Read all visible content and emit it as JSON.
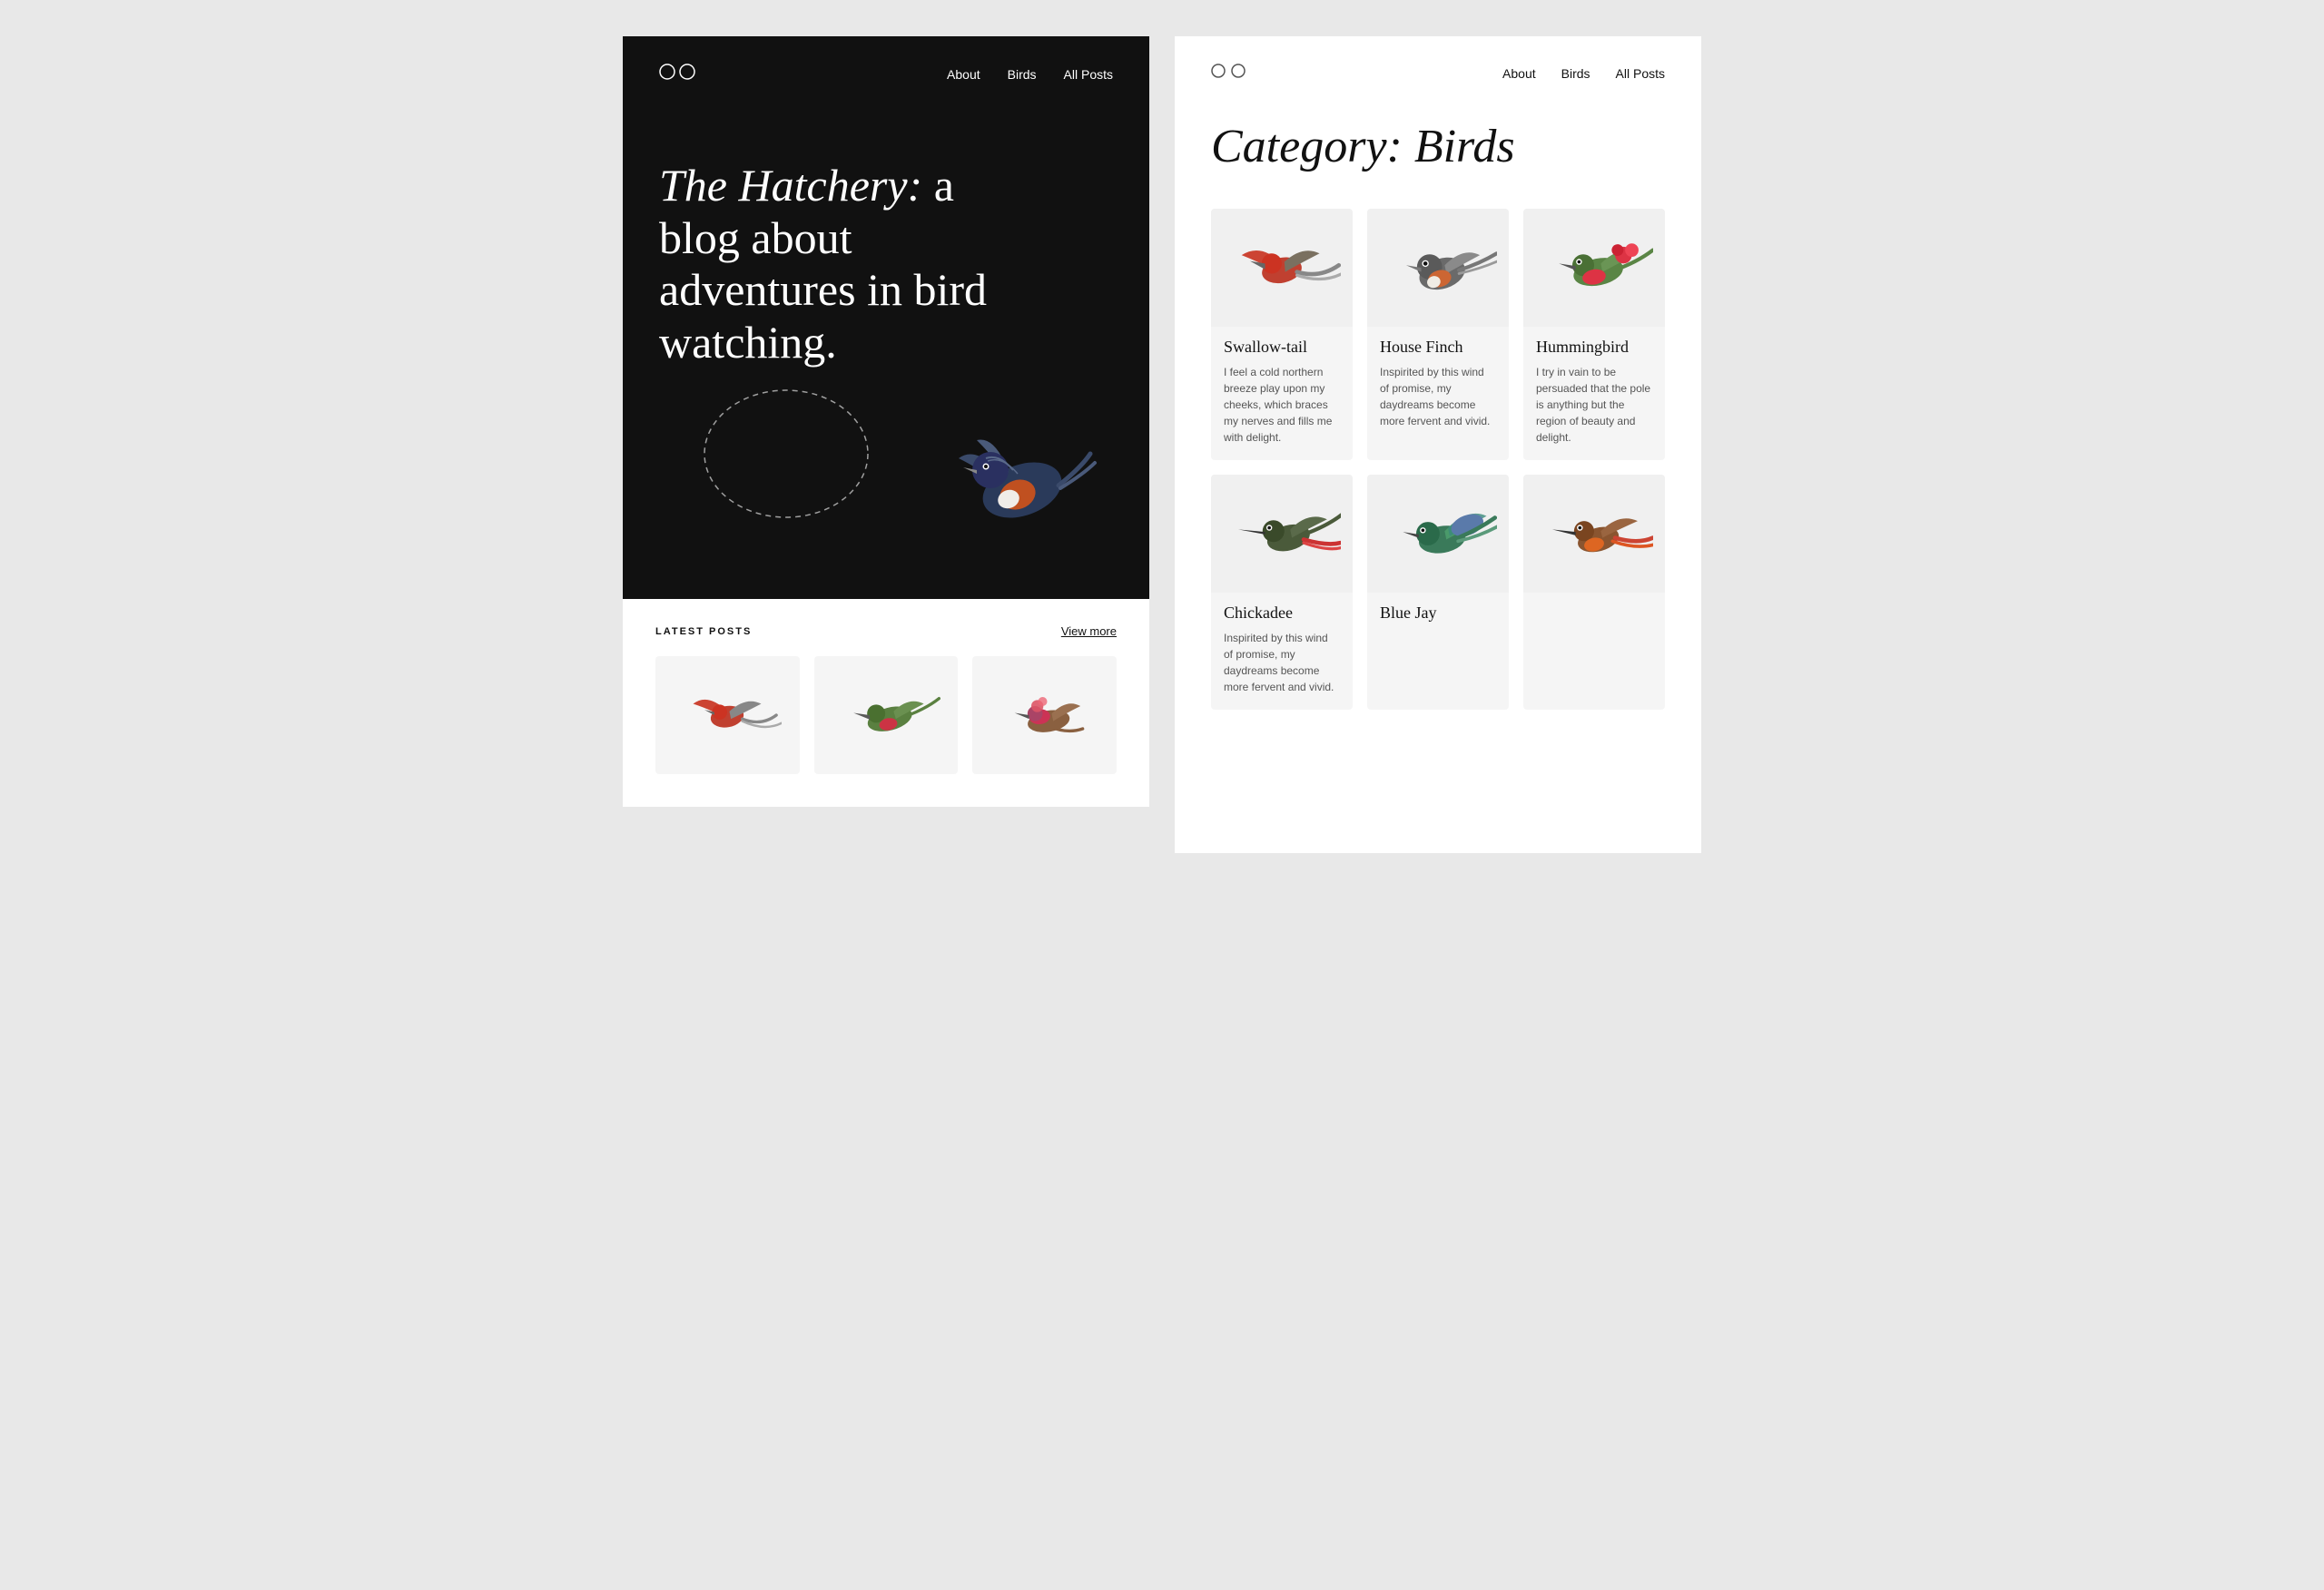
{
  "left": {
    "logo": "oo",
    "nav": {
      "links": [
        "About",
        "Birds",
        "All Posts"
      ]
    },
    "hero": {
      "title_italic": "The Hatchery:",
      "title_normal": " a blog about adventures in bird watching."
    },
    "latest": {
      "label": "LATEST POSTS",
      "view_more": "View more"
    }
  },
  "right": {
    "logo": "oo",
    "nav": {
      "links": [
        "About",
        "Birds",
        "All Posts"
      ]
    },
    "category_title": "Category: Birds",
    "birds": [
      {
        "name": "Swallow-tail",
        "desc": "I feel a cold northern breeze play upon my cheeks, which braces my nerves and fills me with delight.",
        "color": "#cc4444"
      },
      {
        "name": "House Finch",
        "desc": "Inspirited by this wind of promise, my daydreams become more fervent and vivid.",
        "color": "#888888"
      },
      {
        "name": "Hummingbird",
        "desc": "I try in vain to be persuaded that the pole is anything but the region of beauty and delight.",
        "color": "#dd4455"
      },
      {
        "name": "Chickadee",
        "desc": "Inspirited by this wind of promise, my daydreams become more fervent and vivid.",
        "color": "#5a7a3a"
      },
      {
        "name": "Blue Jay",
        "desc": "",
        "color": "#4a6b9a"
      }
    ]
  }
}
